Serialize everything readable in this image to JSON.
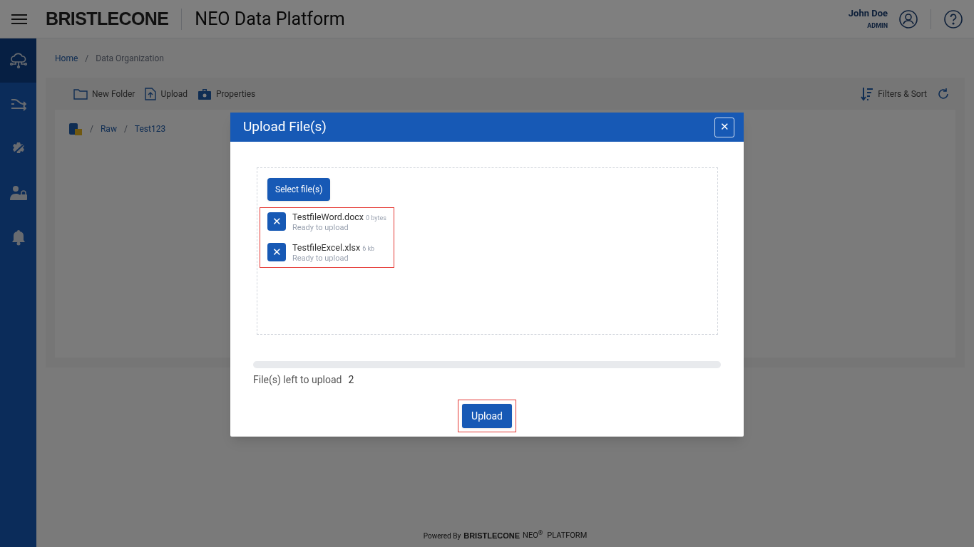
{
  "header": {
    "brand": "BRISTLECONE",
    "app_title": "NEO Data Platform",
    "user_name": "John Doe",
    "user_role": "ADMIN"
  },
  "sidebar": {
    "items": [
      {
        "kind": "cloud",
        "selected": true
      },
      {
        "kind": "flow",
        "selected": false
      },
      {
        "kind": "gear",
        "selected": false
      },
      {
        "kind": "userlock",
        "selected": false
      },
      {
        "kind": "bell",
        "selected": false
      }
    ]
  },
  "breadcrumbs": {
    "separator": "/",
    "items": [
      "Home",
      "Data Organization"
    ]
  },
  "toolbar": {
    "actions": [
      {
        "kind": "folder",
        "label": "New Folder"
      },
      {
        "kind": "upload",
        "label": "Upload"
      },
      {
        "kind": "briefcase",
        "label": "Properties"
      }
    ],
    "filters_label": "Filters & Sort"
  },
  "path": {
    "separator": "/",
    "items": [
      "Raw",
      "Test123"
    ]
  },
  "dialog": {
    "title": "Upload File(s)",
    "close": "✕",
    "select_button": "Select file(s)",
    "remove_glyph": "✕",
    "files": [
      {
        "name": "TestfileWord.docx",
        "size": "0 bytes",
        "status": "Ready to upload"
      },
      {
        "name": "TestfileExcel.xlsx",
        "size": "6 kb",
        "status": "Ready to upload"
      }
    ],
    "progress": {
      "level": 0
    },
    "left_label": "File(s) left to upload",
    "left_count": "2",
    "upload_button": "Upload"
  },
  "footer": {
    "powered": "Powered By",
    "brand": "BRISTLECONE",
    "product": "NEO$^{®}$",
    "platform": "PLATFORM"
  }
}
